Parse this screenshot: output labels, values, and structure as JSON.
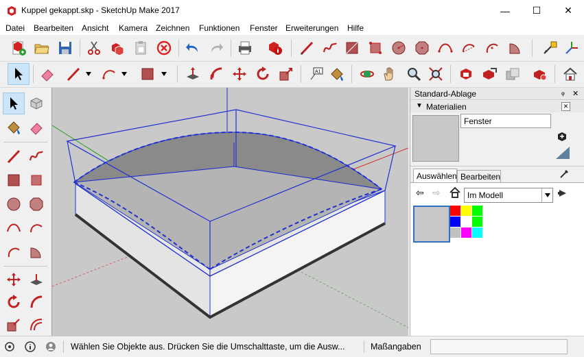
{
  "window": {
    "title": "Kuppel gekappt.skp - SketchUp Make 2017",
    "minimize": "—",
    "maximize": "☐",
    "close": "✕"
  },
  "menu": [
    "Datei",
    "Bearbeiten",
    "Ansicht",
    "Kamera",
    "Zeichnen",
    "Funktionen",
    "Fenster",
    "Erweiterungen",
    "Hilfe"
  ],
  "tray": {
    "title": "Standard-Ablage",
    "pin": "ᵩ",
    "close": "✕",
    "section": "Materialien",
    "material_name": "Fenster",
    "tabs": [
      "Auswählen",
      "Bearbeiten"
    ],
    "collection": "Im Modell",
    "colors": [
      "#ff0000",
      "#ffff00",
      "#00ff00",
      "#0000ff",
      "#ffffff",
      "#00ff00",
      "#c0c0c0",
      "#ff00ff",
      "#00ffff"
    ]
  },
  "statusbar": {
    "hint": "Wählen Sie Objekte aus. Drücken Sie die Umschalttaste, um die Ausw...",
    "measure_label": "Maßangaben"
  }
}
